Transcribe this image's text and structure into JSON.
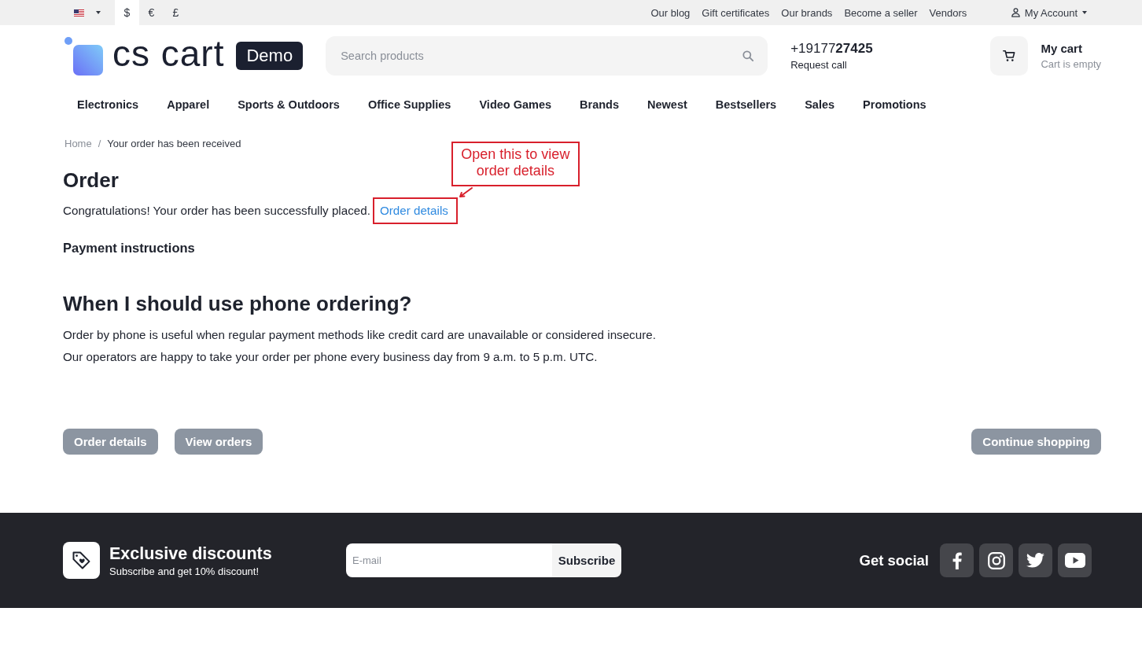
{
  "top_bar": {
    "currencies": [
      {
        "symbol": "$",
        "selected": true
      },
      {
        "symbol": "€",
        "selected": false
      },
      {
        "symbol": "£",
        "selected": false
      }
    ],
    "links": [
      "Our blog",
      "Gift certificates",
      "Our brands",
      "Become a seller",
      "Vendors"
    ],
    "account": "My Account"
  },
  "header": {
    "logo": {
      "text": "cs cart",
      "badge": "Demo"
    },
    "search": {
      "placeholder": "Search products"
    },
    "phone": {
      "number": "+19177**27425**",
      "action": "Request call"
    },
    "cart": {
      "title": "My cart",
      "status": "Cart is empty"
    }
  },
  "nav": [
    "Electronics",
    "Apparel",
    "Sports & Outdoors",
    "Office Supplies",
    "Video Games",
    "Brands",
    "Newest",
    "Bestsellers",
    "Sales",
    "Promotions"
  ],
  "breadcrumb": {
    "separator": "/",
    "items": [
      {
        "label": "Home",
        "kind": "link"
      },
      {
        "label": "Your order has been received",
        "kind": "current"
      }
    ]
  },
  "order": {
    "title": "Order",
    "annotation": {
      "callout": "Open this to view order details"
    },
    "message": "Congratulations! Your order has been successfully placed.",
    "link": "Order details",
    "payment_heading": "Payment instructions"
  },
  "info": {
    "title": "When I should use phone ordering?",
    "paragraphs": [
      "Order by phone is useful when regular payment methods like credit card are unavailable or considered insecure.",
      "Our operators are happy to take your order per phone every business day from 9 a.m. to 5 p.m. UTC."
    ]
  },
  "actions": {
    "left": [
      "Order details",
      "View orders"
    ],
    "right": [
      "Continue shopping"
    ]
  },
  "footer": {
    "promo": {
      "title": "Exclusive discounts",
      "subtitle": "Subscribe and get 10% discount!"
    },
    "subscribe": {
      "placeholder": "E-mail",
      "button": "Subscribe"
    },
    "social": {
      "label": "Get social",
      "networks": [
        {
          "kind": "facebook"
        },
        {
          "kind": "instagram"
        },
        {
          "kind": "twitter"
        },
        {
          "kind": "youtube"
        }
      ]
    }
  }
}
